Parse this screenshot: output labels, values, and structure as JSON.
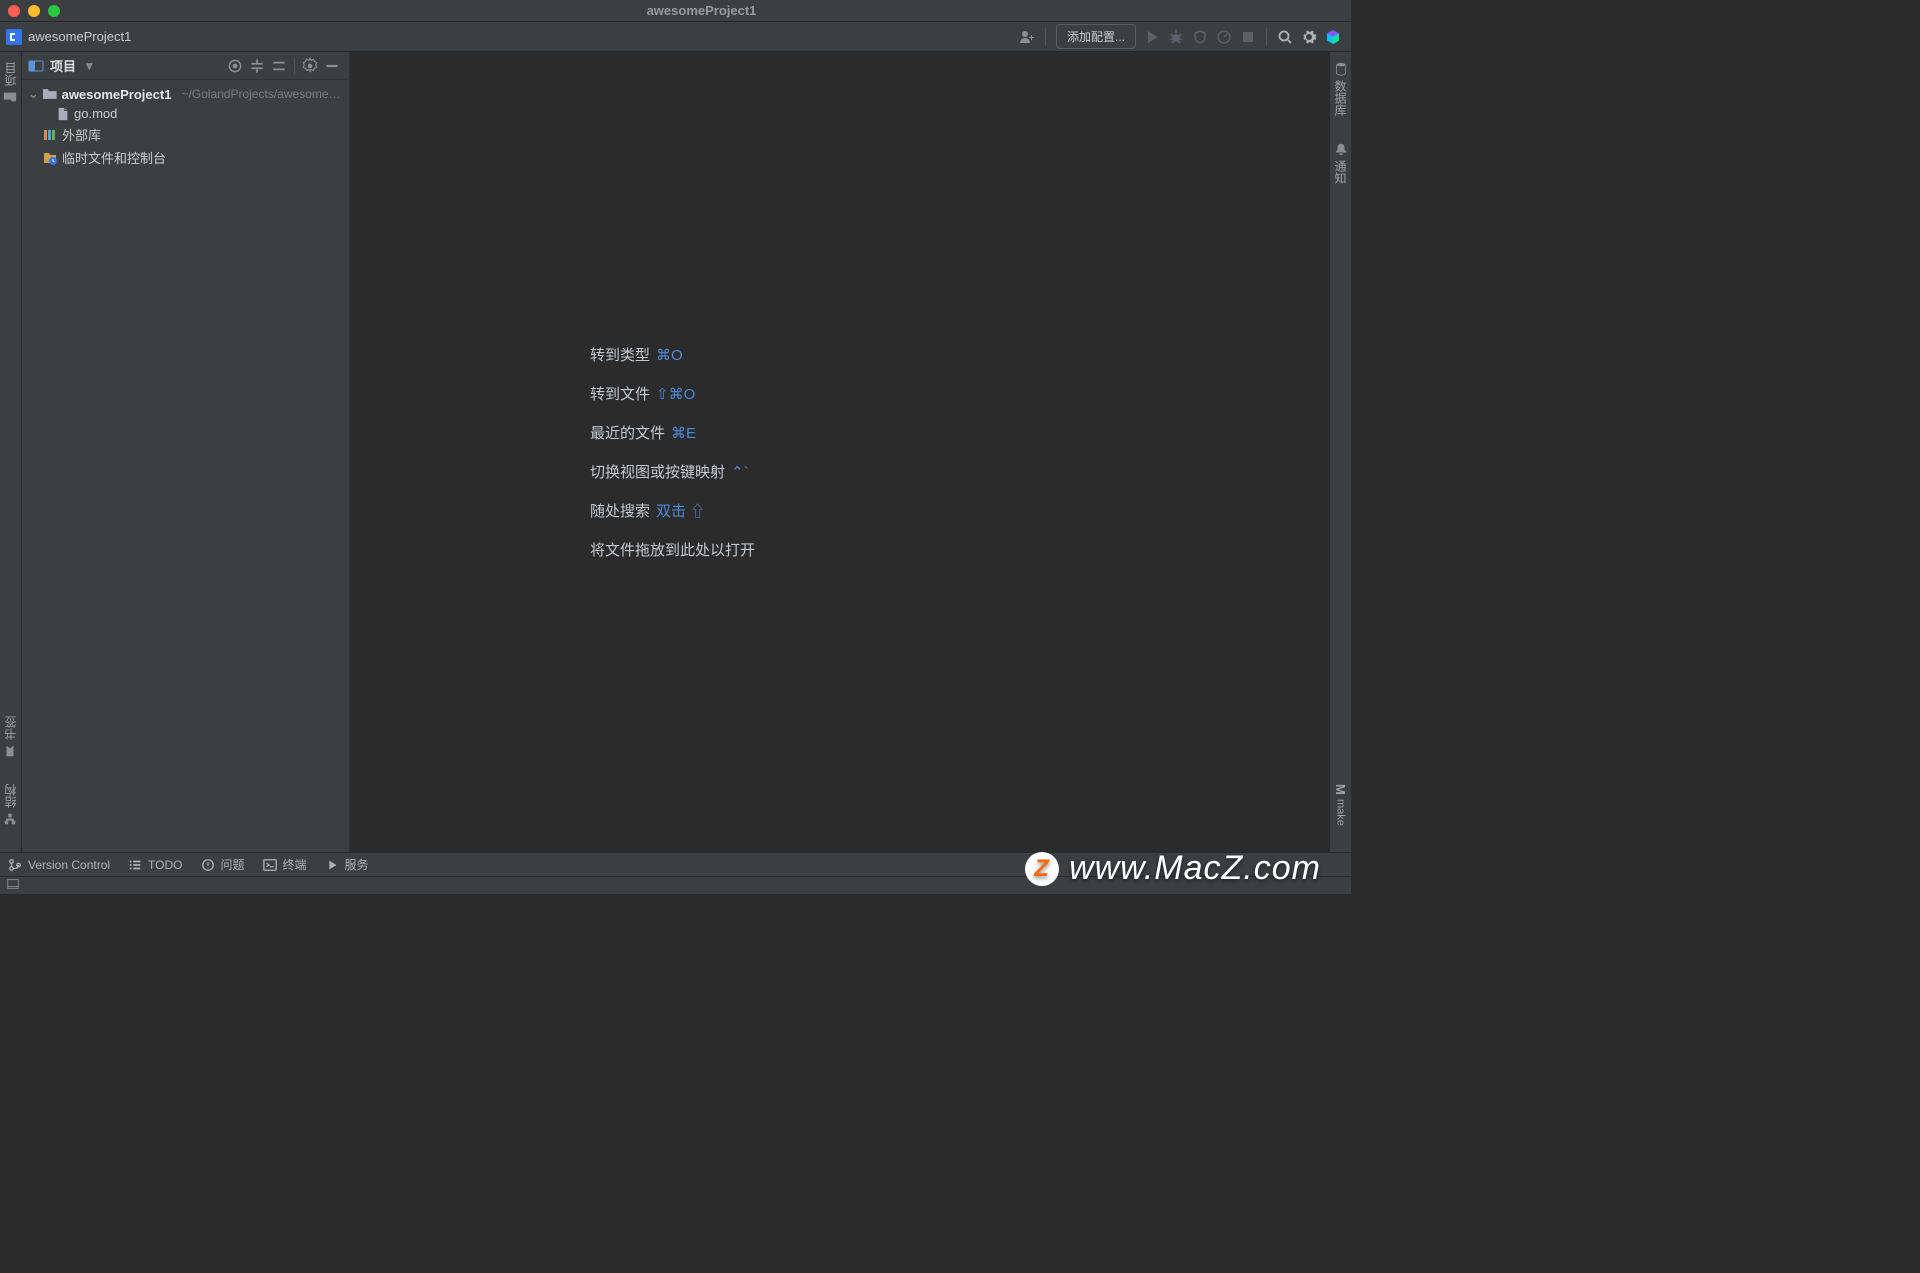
{
  "window": {
    "title": "awesomeProject1"
  },
  "breadcrumb": {
    "project": "awesomeProject1"
  },
  "toolbar": {
    "add_config": "添加配置..."
  },
  "sidebar": {
    "title": "项目",
    "root_name": "awesomeProject1",
    "root_path": "~/GolandProjects/awesomePro",
    "file_go_mod": "go.mod",
    "external_libs": "外部库",
    "scratches": "临时文件和控制台"
  },
  "left_gutter": {
    "project": "项目",
    "bookmarks": "书签",
    "structure": "结构"
  },
  "right_gutter": {
    "database": "数据库",
    "notifications": "通知",
    "make": "make"
  },
  "hints": {
    "goto_type": {
      "label": "转到类型",
      "shortcut": "⌘O"
    },
    "goto_file": {
      "label": "转到文件",
      "shortcut": "⇧⌘O"
    },
    "recent_files": {
      "label": "最近的文件",
      "shortcut": "⌘E"
    },
    "switcher": {
      "label": "切换视图或按键映射",
      "shortcut": "⌃`"
    },
    "search_everywhere": {
      "label": "随处搜索",
      "shortcut": "双击 ⇧"
    },
    "drop_files": {
      "label": "将文件拖放到此处以打开"
    }
  },
  "bottom": {
    "version_control": "Version Control",
    "todo": "TODO",
    "problems": "问题",
    "terminal": "终端",
    "services": "服务"
  },
  "watermark": {
    "text": "www.MacZ.com",
    "badge": "Z"
  }
}
